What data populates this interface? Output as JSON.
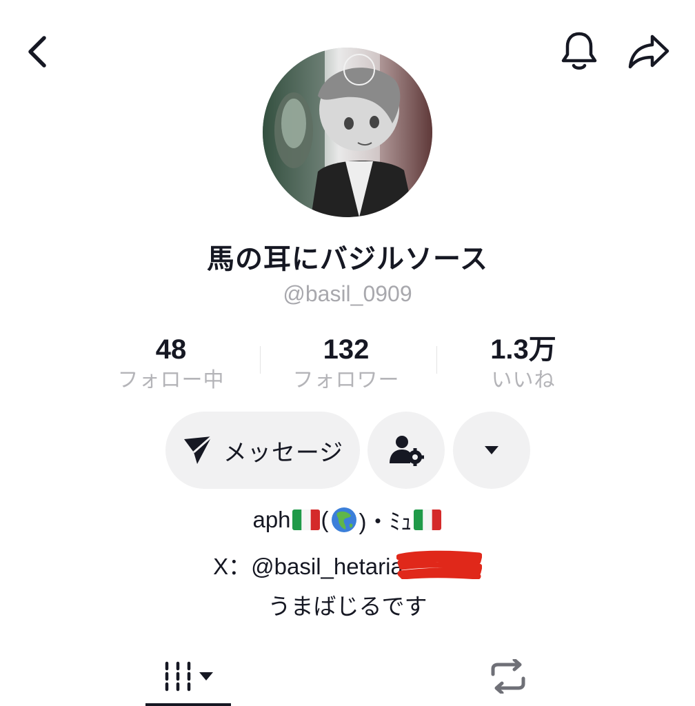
{
  "header": {
    "back_icon": "chevron-left-icon",
    "bell_icon": "bell-icon",
    "share_icon": "share-arrow-icon"
  },
  "profile": {
    "display_name": "馬の耳にバジルソース",
    "username": "@basil_0909",
    "avatar_icon": "profile-avatar-image"
  },
  "stats": [
    {
      "value": "48",
      "label": "フォロー中"
    },
    {
      "value": "132",
      "label": "フォロワー"
    },
    {
      "value": "1.3万",
      "label": "いいね"
    }
  ],
  "actions": {
    "message_label": "メッセージ",
    "message_icon": "paper-plane-icon",
    "add_friend_icon": "person-gear-icon",
    "dropdown_icon": "caret-down-icon"
  },
  "bio": {
    "line1_part1": "aph",
    "line1_part2": "(",
    "line1_part3": ")・ﾐｭ",
    "line2": "X：@basil_hetaria",
    "line3": "うまばじるです",
    "flag_icon": "italy-flag-icon",
    "globe_icon": "globe-asia-icon"
  },
  "tabs": {
    "videos_icon": "grid-videos-icon",
    "videos_dropdown_icon": "caret-down-icon",
    "reposts_icon": "repost-icon"
  },
  "colors": {
    "text_primary": "#161823",
    "text_secondary": "#a8a8ad",
    "button_bg": "#f1f1f2",
    "redaction": "#e0281a",
    "flag_green": "#1f9a48",
    "flag_red": "#d42a2a"
  }
}
